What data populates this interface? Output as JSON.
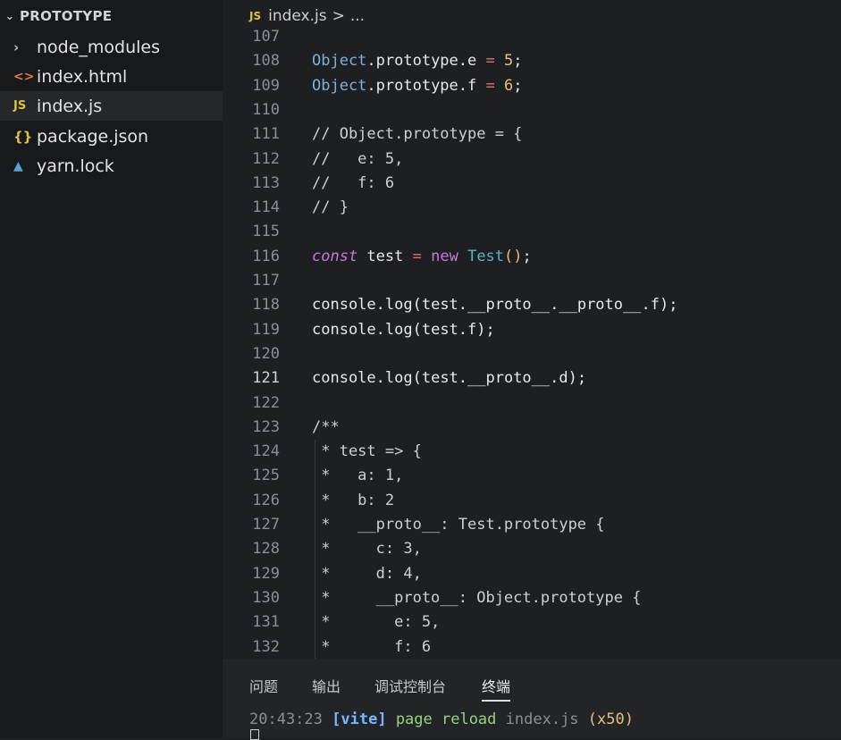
{
  "explorer": {
    "title": "PROTOTYPE",
    "items": [
      {
        "label": "node_modules",
        "icon": "chevron-right-icon"
      },
      {
        "label": "index.html",
        "icon": "html-file-icon"
      },
      {
        "label": "index.js",
        "icon": "js-file-icon",
        "active": true
      },
      {
        "label": "package.json",
        "icon": "json-file-icon"
      },
      {
        "label": "yarn.lock",
        "icon": "yarn-file-icon"
      }
    ]
  },
  "editor": {
    "breadcrumb": {
      "file": "index.js",
      "separator": ">",
      "more": "..."
    },
    "lines": [
      {
        "n": "107",
        "text": ""
      },
      {
        "n": "108",
        "text": "Object.prototype.e = 5;"
      },
      {
        "n": "109",
        "text": "Object.prototype.f = 6;"
      },
      {
        "n": "110",
        "text": ""
      },
      {
        "n": "111",
        "text": "// Object.prototype = {"
      },
      {
        "n": "112",
        "text": "//   e: 5,"
      },
      {
        "n": "113",
        "text": "//   f: 6"
      },
      {
        "n": "114",
        "text": "// }"
      },
      {
        "n": "115",
        "text": ""
      },
      {
        "n": "116",
        "text": "const test = new Test();"
      },
      {
        "n": "117",
        "text": ""
      },
      {
        "n": "118",
        "text": "console.log(test.__proto__.__proto__.f);"
      },
      {
        "n": "119",
        "text": "console.log(test.f);"
      },
      {
        "n": "120",
        "text": ""
      },
      {
        "n": "121",
        "text": "console.log(test.__proto__.d);"
      },
      {
        "n": "122",
        "text": ""
      },
      {
        "n": "123",
        "text": "/**"
      },
      {
        "n": "124",
        "text": " * test => {"
      },
      {
        "n": "125",
        "text": " *   a: 1,"
      },
      {
        "n": "126",
        "text": " *   b: 2"
      },
      {
        "n": "127",
        "text": " *   __proto__: Test.prototype {"
      },
      {
        "n": "128",
        "text": " *     c: 3,"
      },
      {
        "n": "129",
        "text": " *     d: 4,"
      },
      {
        "n": "130",
        "text": " *     __proto__: Object.prototype {"
      },
      {
        "n": "131",
        "text": " *       e: 5,"
      },
      {
        "n": "132",
        "text": " *       f: 6"
      }
    ]
  },
  "panel": {
    "tabs": [
      "问题",
      "输出",
      "调试控制台",
      "终端"
    ],
    "active_tab": "终端",
    "terminal": {
      "time": "20:43:23",
      "tag": "[vite]",
      "message": "page reload",
      "file": "index.js",
      "count": "(x50)"
    }
  },
  "colors": {
    "editor_bg": "#1e1f22",
    "sidebar_bg": "#18191c",
    "panel_bg": "#232428",
    "keyword": "#c678dd",
    "number": "#e7c07a",
    "class": "#56b6c2",
    "function": "#61afef"
  }
}
